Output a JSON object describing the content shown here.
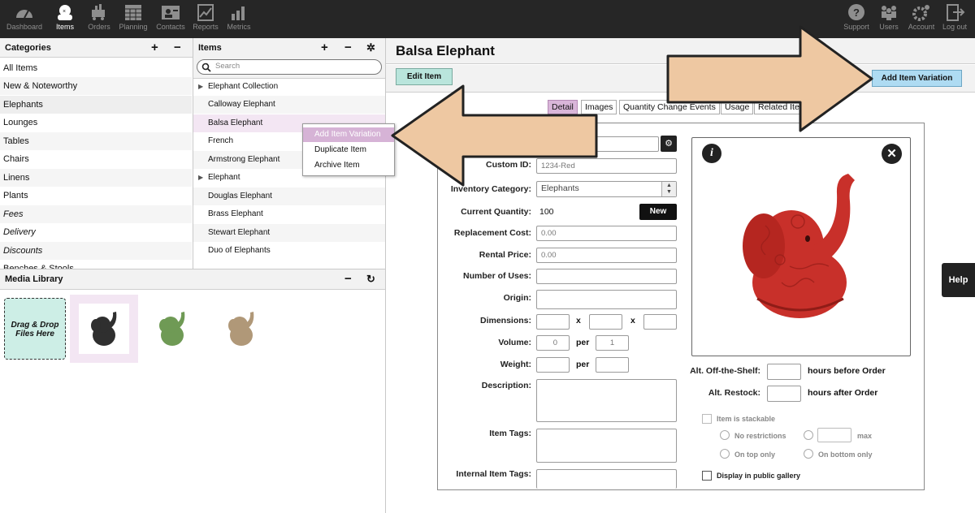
{
  "nav": {
    "left": [
      {
        "label": "Dashboard",
        "icon": "dashboard-gauge-icon"
      },
      {
        "label": "Items",
        "icon": "items-icon"
      },
      {
        "label": "Orders",
        "icon": "orders-cart-icon"
      },
      {
        "label": "Planning",
        "icon": "planning-calendar-icon"
      },
      {
        "label": "Contacts",
        "icon": "contacts-card-icon"
      },
      {
        "label": "Reports",
        "icon": "reports-chart-icon"
      },
      {
        "label": "Metrics",
        "icon": "metrics-bars-icon"
      }
    ],
    "right": [
      {
        "label": "Support",
        "icon": "support-question-icon"
      },
      {
        "label": "Users",
        "icon": "users-icon"
      },
      {
        "label": "Account",
        "icon": "account-gear-icon"
      },
      {
        "label": "Log out",
        "icon": "logout-icon"
      }
    ]
  },
  "categories": {
    "title": "Categories",
    "items": [
      "All Items",
      "New & Noteworthy",
      "Elephants",
      "Lounges",
      "Tables",
      "Chairs",
      "Linens",
      "Plants",
      "Fees",
      "Delivery",
      "Discounts",
      "Benches & Stools"
    ]
  },
  "items_panel": {
    "title": "Items",
    "search_placeholder": "Search",
    "items": [
      "Elephant Collection",
      "Calloway Elephant",
      "Balsa Elephant",
      "French",
      "Armstrong Elephant",
      "Elephant",
      "Douglas Elephant",
      "Brass Elephant",
      "Stewart Elephant",
      "Duo of Elephants"
    ]
  },
  "context_menu": [
    "Add Item Variation",
    "Duplicate Item",
    "Archive Item"
  ],
  "media": {
    "title": "Media Library",
    "dropzone": "Drag & Drop Files Here",
    "thumb_colors": [
      "#2f2f2f",
      "#6f9a55",
      "#b09878"
    ]
  },
  "detail": {
    "title": "Balsa Elephant",
    "edit_button": "Edit Item",
    "add_variation_button": "Add Item Variation",
    "tabs": [
      "Detail",
      "Images",
      "Quantity Change Events",
      "Usage",
      "Related Ite"
    ],
    "fields": {
      "custom_id_label": "Custom ID:",
      "custom_id_value": "1234-Red",
      "inventory_category_label": "Inventory Category:",
      "inventory_category_value": "Elephants",
      "current_quantity_label": "Current Quantity:",
      "current_quantity_value": "100",
      "new_button": "New",
      "replacement_cost_label": "Replacement Cost:",
      "replacement_cost_value": "0.00",
      "rental_price_label": "Rental Price:",
      "rental_price_value": "0.00",
      "number_of_uses_label": "Number of Uses:",
      "origin_label": "Origin:",
      "dimensions_label": "Dimensions:",
      "x1": "x",
      "x2": "x",
      "volume_label": "Volume:",
      "volume_value": "0",
      "per1": "per",
      "volume_per_value": "1",
      "weight_label": "Weight:",
      "per2": "per",
      "description_label": "Description:",
      "item_tags_label": "Item Tags:",
      "internal_item_tags_label": "Internal Item Tags:"
    },
    "right": {
      "alt_off_shelf_label": "Alt. Off-the-Shelf:",
      "hours_before": "hours before Order",
      "alt_restock_label": "Alt. Restock:",
      "hours_after": "hours after Order",
      "stackable": "Item is stackable",
      "no_restrictions": "No restrictions",
      "max": "max",
      "on_top_only": "On top only",
      "on_bottom_only": "On bottom only",
      "display_public": "Display in public gallery"
    },
    "image_color": "#c8302a"
  },
  "help": "Help",
  "arrow_color": "#eec8a2"
}
